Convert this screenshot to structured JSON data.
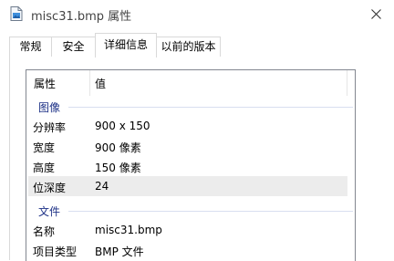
{
  "window": {
    "title": "misc31.bmp 属性",
    "icon": "bitmap-file-icon",
    "close_icon": "close-icon"
  },
  "tabs": [
    {
      "label": "常规",
      "active": false
    },
    {
      "label": "安全",
      "active": false
    },
    {
      "label": "详细信息",
      "active": true
    },
    {
      "label": "以前的版本",
      "active": false
    }
  ],
  "details": {
    "columns": {
      "property": "属性",
      "value": "值"
    },
    "sections": [
      {
        "title": "图像",
        "rows": [
          {
            "label": "分辨率",
            "value": "900 x 150"
          },
          {
            "label": "宽度",
            "value": "900 像素"
          },
          {
            "label": "高度",
            "value": "150 像素"
          },
          {
            "label": "位深度",
            "value": "24",
            "selected": true
          }
        ]
      },
      {
        "title": "文件",
        "rows": [
          {
            "label": "名称",
            "value": "misc31.bmp"
          },
          {
            "label": "项目类型",
            "value": "BMP 文件"
          }
        ]
      }
    ]
  }
}
